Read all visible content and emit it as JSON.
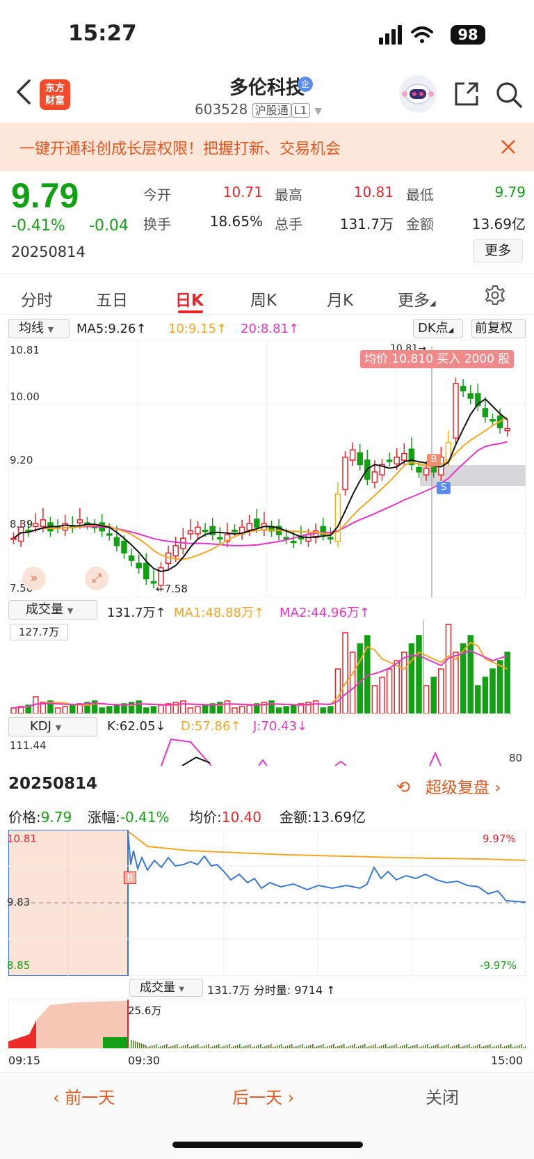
{
  "status_bar": {
    "time": "15:27",
    "battery": "98"
  },
  "header": {
    "logo": "东方\n财富",
    "stock_name": "多伦科技",
    "verified_badge": "企",
    "stock_code": "603528",
    "exchange_tag": "沪股通",
    "level_tag": "L1"
  },
  "banner": {
    "text": "一键开通科创成长层权限！把握打新、交易机会"
  },
  "quote": {
    "price": "9.79",
    "change_pct": "-0.41%",
    "change_abs": "-0.04",
    "date": "20250814",
    "fields": [
      {
        "label": "今开",
        "value": "10.71",
        "color": "#e8242a"
      },
      {
        "label": "最高",
        "value": "10.81",
        "color": "#e8242a"
      },
      {
        "label": "最低",
        "value": "9.79",
        "color": "#14a014"
      },
      {
        "label": "换手",
        "value": "18.65%",
        "color": "#222222"
      },
      {
        "label": "总手",
        "value": "131.7万",
        "color": "#222222"
      },
      {
        "label": "金额",
        "value": "13.69亿",
        "color": "#222222"
      }
    ],
    "more_label": "更多"
  },
  "tabs": [
    "分时",
    "五日",
    "日K",
    "周K",
    "月K",
    "更多"
  ],
  "active_tab": "日K",
  "kline": {
    "indicator_select": "均线",
    "ma5": "MA5:9.26",
    "ma10": "10:9.15",
    "ma20": "20:8.81",
    "dk_label": "DK点",
    "adjust_label": "前复权",
    "y_labels": [
      "10.81",
      "10.00",
      "9.20",
      "8.39",
      "7.58"
    ],
    "high_marker": "10.81",
    "low_marker": "7.58",
    "trade_note": "均价 10.810 买入 2000 股",
    "buy_marker": "B",
    "sell_marker": "S"
  },
  "volume": {
    "select": "成交量",
    "value": "131.7万",
    "ma1": "MA1:48.88万",
    "ma2": "MA2:44.96万",
    "max_label": "127.7万"
  },
  "kdj": {
    "select": "KDJ",
    "k": "K:62.05",
    "d": "D:57.86",
    "j": "J:70.43",
    "top_label": "111.44",
    "right_label": "80"
  },
  "intraday": {
    "date": "20250814",
    "replay_label": "超级复盘",
    "price_label": "价格:",
    "price": "9.79",
    "chg_label": "涨幅:",
    "chg": "-0.41%",
    "avg_label": "均价:",
    "avg": "10.40",
    "amount_label": "金额:",
    "amount": "13.69亿",
    "y_top": "10.81",
    "y_mid": "9.83",
    "y_bot": "8.85",
    "pct_top": "9.97%",
    "pct_bot": "-9.97%",
    "buy_marker": "B",
    "vol_select": "成交量",
    "vol_text": "131.7万 分时量: 9714",
    "vol_max": "25.6万",
    "times": [
      "09:15",
      "09:30",
      "15:00"
    ]
  },
  "bottom": {
    "prev": "前一天",
    "next": "后一天",
    "close": "关闭"
  },
  "colors": {
    "up": "#e8242a",
    "down": "#14a014",
    "ma5": "#111111",
    "ma10": "#f5a623",
    "ma20": "#e535c6",
    "accent": "#e25a22"
  }
}
